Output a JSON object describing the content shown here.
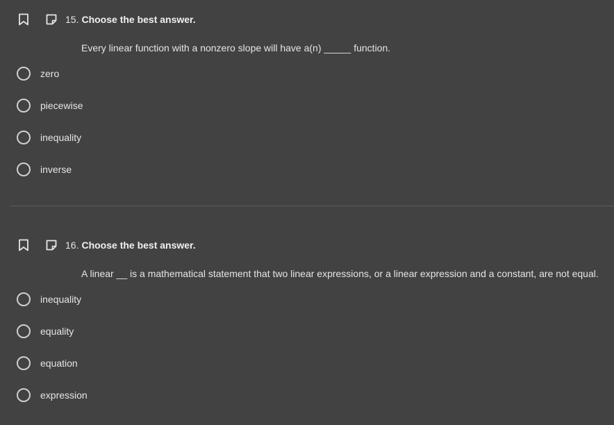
{
  "questions": [
    {
      "number": "15.",
      "title": "Choose the best answer.",
      "stem": "Every linear function with a nonzero slope will have a(n) _____ function.",
      "options": [
        "zero",
        "piecewise",
        "inequality",
        "inverse"
      ]
    },
    {
      "number": "16.",
      "title": "Choose the best answer.",
      "stem": "A linear __ is a mathematical statement that two linear expressions, or a linear expression and a constant, are not equal.",
      "options": [
        "inequality",
        "equality",
        "equation",
        "expression"
      ]
    }
  ],
  "icons": {
    "bookmark": "bookmark-icon",
    "note": "note-icon"
  },
  "colors": {
    "background": "#424242",
    "text": "#e6e6e6",
    "radio_border": "#d0d0d0",
    "divider": "#5a5a5a"
  }
}
